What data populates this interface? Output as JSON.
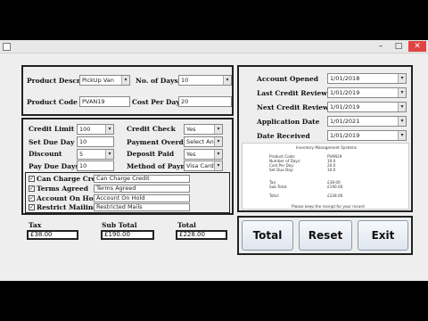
{
  "product": {
    "description_label": "Product Description",
    "description_value": "PickUp Van",
    "code_label": "Product Code",
    "code_value": "PVAN19",
    "days_label": "No. of Days",
    "days_value": "10",
    "cost_label": "Cost Per Day(£)",
    "cost_value": "20"
  },
  "credit": {
    "limit_label": "Credit Limit",
    "limit_value": "100",
    "check_label": "Credit Check",
    "check_value": "Yes",
    "set_due_label": "Set Due Day",
    "set_due_value": "10",
    "payment_overdue_label": "Payment Overdue",
    "payment_overdue_value": "Select An Option",
    "discount_label": "Discount",
    "discount_value": "5",
    "deposit_label": "Deposit Paid",
    "deposit_value": "Yes",
    "pay_due_label": "Pay Due Days",
    "pay_due_value": "10",
    "method_label": "Method of Payment",
    "method_value": "Visa Card"
  },
  "checks": [
    {
      "label": "Can Charge Credit",
      "value": "Can Charge Credit",
      "checked": true
    },
    {
      "label": "Terms Agreed",
      "value": "Terms Agreed",
      "checked": true
    },
    {
      "label": "Account On Hold",
      "value": "Account On Hold",
      "checked": true
    },
    {
      "label": "Restrict Mailing",
      "value": "Restricted Mails",
      "checked": true
    }
  ],
  "totals": {
    "tax_label": "Tax",
    "tax_value": "£38.00",
    "subtotal_label": "Sub Total",
    "subtotal_value": "£190.00",
    "total_label": "Total",
    "total_value": "£228.00"
  },
  "dates": {
    "opened_label": "Account Opened",
    "opened_value": "1/01/2018",
    "last_review_label": "Last Credit Review",
    "last_review_value": "1/01/2019",
    "next_review_label": "Next Credit Review",
    "next_review_value": "1/01/2019",
    "application_label": "Application Date",
    "application_value": "1/01/2021",
    "received_label": "Date Received",
    "received_value": "1/01/2019"
  },
  "receipt": {
    "title": "Inventory Management Systems",
    "rows": [
      {
        "k": "Product Code:",
        "v": "PVAN19"
      },
      {
        "k": "Number of Days:",
        "v": "10.0"
      },
      {
        "k": "Cost Per Day:",
        "v": "20.0"
      },
      {
        "k": "Set Due Day:",
        "v": "10.0"
      }
    ],
    "totals": [
      {
        "k": "Tax:",
        "v": "£38.00"
      },
      {
        "k": "Sub Total:",
        "v": "£190.00"
      },
      {
        "k": "Total:",
        "v": "£228.00"
      }
    ],
    "footer": "Please keep the receipt for your record"
  },
  "buttons": {
    "total": "Total",
    "reset": "Reset",
    "exit": "Exit"
  },
  "window_controls": {
    "minimize": "–",
    "maximize": "□",
    "close": "✕"
  }
}
